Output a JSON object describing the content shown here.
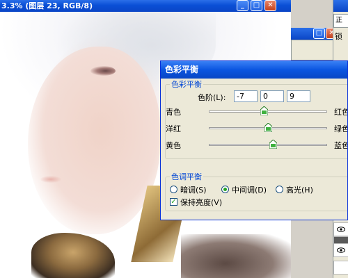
{
  "document_window": {
    "title": "3.3% (图层 23, RGB/8)",
    "min_glyph": "_",
    "max_glyph": "□",
    "close_glyph": "✕"
  },
  "layers_panel": {
    "tab_label": "正",
    "lock_label": "锁"
  },
  "color_balance_dialog": {
    "title": "色彩平衡",
    "color_balance_group": {
      "legend": "色彩平衡",
      "levels_label": "色阶(L):",
      "levels_values": [
        "-7",
        "0",
        "9"
      ],
      "sliders": [
        {
          "left": "青色",
          "right": "红色",
          "value": -7
        },
        {
          "left": "洋红",
          "right": "绿色",
          "value": 0
        },
        {
          "left": "黄色",
          "right": "蓝色",
          "value": 9
        }
      ],
      "slider_range": [
        -100,
        100
      ]
    },
    "tone_balance_group": {
      "legend": "色调平衡",
      "shadows_label": "暗调(S)",
      "midtones_label": "中间调(D)",
      "highlights_label": "高光(H)",
      "selected_tone": "midtones",
      "preserve_luminosity_label": "保持亮度(V)",
      "preserve_luminosity_checked": true
    }
  },
  "colors": {
    "title_blue": "#0a55e0",
    "dialog_face": "#ece9d8",
    "legend_blue": "#0046d5",
    "radio_green": "#21a121"
  }
}
